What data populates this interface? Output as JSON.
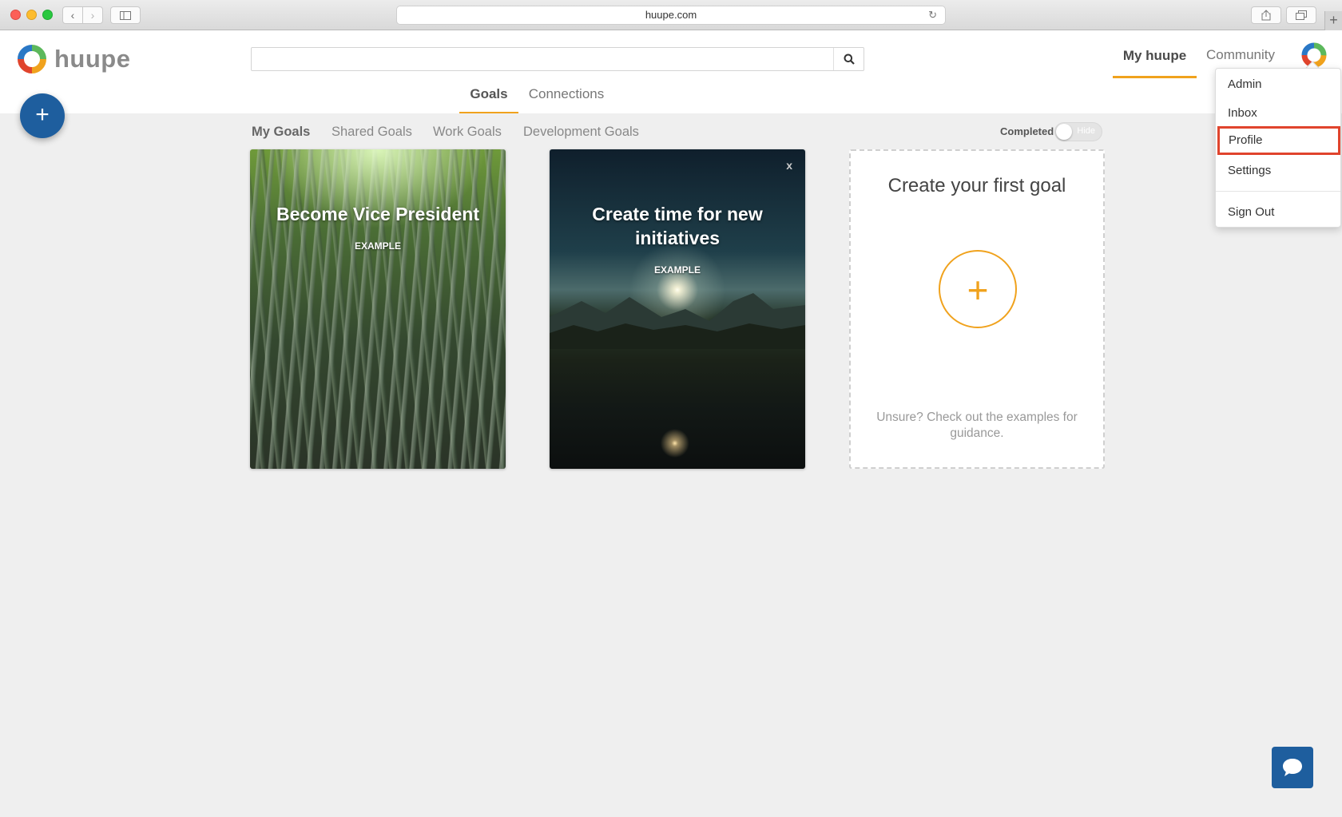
{
  "browser": {
    "url": "huupe.com"
  },
  "app": {
    "brand": "huupe"
  },
  "search": {
    "placeholder": "",
    "value": ""
  },
  "topnav": {
    "my_huupe": "My huupe",
    "community": "Community"
  },
  "subtabs": {
    "goals": "Goals",
    "connections": "Connections"
  },
  "filters": {
    "my_goals": "My Goals",
    "shared_goals": "Shared Goals",
    "work_goals": "Work Goals",
    "development_goals": "Development Goals",
    "completed_label": "Completed",
    "toggle_label": "Hide"
  },
  "cards": [
    {
      "title": "Become Vice President",
      "tag": "EXAMPLE"
    },
    {
      "title": "Create time for new initiatives",
      "tag": "EXAMPLE",
      "close": "x"
    }
  ],
  "create_card": {
    "title": "Create your first goal",
    "plus": "+",
    "hint": "Unsure? Check out the examples for guidance."
  },
  "fab": {
    "label": "+"
  },
  "menu": {
    "items": [
      "Admin",
      "Inbox",
      "Profile",
      "Settings",
      "Sign Out"
    ],
    "highlighted": "Profile"
  },
  "colors": {
    "accent": "#f0a21d",
    "primary": "#1e5e9e",
    "highlight": "#e0442d"
  }
}
